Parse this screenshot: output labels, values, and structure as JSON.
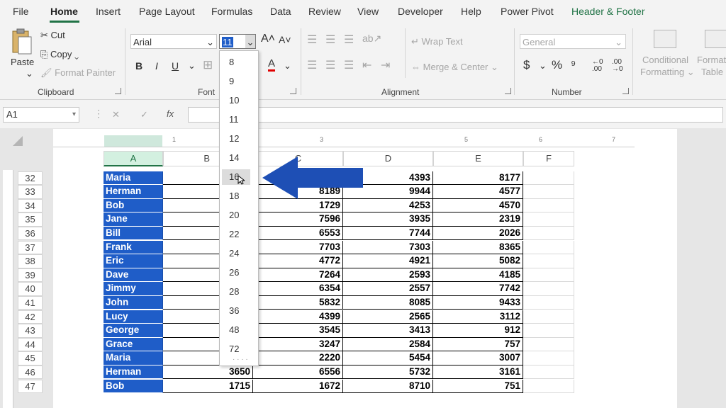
{
  "tabs": [
    "File",
    "Home",
    "Insert",
    "Page Layout",
    "Formulas",
    "Data",
    "Review",
    "View",
    "Developer",
    "Help",
    "Power Pivot",
    "Header & Footer"
  ],
  "clipboard": {
    "paste": "Paste",
    "cut": "Cut",
    "copy": "Copy",
    "format_painter": "Format Painter",
    "label": "Clipboard"
  },
  "font": {
    "name": "Arial",
    "size": "11",
    "bold": "B",
    "italic": "I",
    "underline": "U",
    "label": "Font",
    "font_color_glyph": "A"
  },
  "alignment": {
    "wrap_text": "Wrap Text",
    "merge_center": "Merge & Center",
    "label": "Alignment"
  },
  "number": {
    "format": "General",
    "currency": "$",
    "percent": "%",
    "label": "Number"
  },
  "styles": {
    "conditional": "Conditional",
    "formatting": "Formatting",
    "format_as": "Format a",
    "table": "Table"
  },
  "formula_bar": {
    "name_box": "A1",
    "fx": "fx",
    "cancel": "✕",
    "enter": "✓"
  },
  "ruler_marks": [
    "1",
    "3",
    "5",
    "6",
    "7"
  ],
  "columns": [
    "A",
    "B",
    "C",
    "D",
    "E",
    "F"
  ],
  "rows": [
    {
      "n": "32",
      "name": "Maria",
      "b": "",
      "c": "",
      "d": "4393",
      "e": "8177"
    },
    {
      "n": "33",
      "name": "Herman",
      "b": "",
      "c": "8189",
      "d": "9944",
      "e": "4577"
    },
    {
      "n": "34",
      "name": "Bob",
      "b": "",
      "c": "1729",
      "d": "4253",
      "e": "4570"
    },
    {
      "n": "35",
      "name": "Jane",
      "b": "",
      "c": "7596",
      "d": "3935",
      "e": "2319"
    },
    {
      "n": "36",
      "name": "Bill",
      "b": "",
      "c": "6553",
      "d": "7744",
      "e": "2026"
    },
    {
      "n": "37",
      "name": "Frank",
      "b": "",
      "c": "7703",
      "d": "7303",
      "e": "8365"
    },
    {
      "n": "38",
      "name": "Eric",
      "b": "",
      "c": "4772",
      "d": "4921",
      "e": "5082"
    },
    {
      "n": "39",
      "name": "Dave",
      "b": "",
      "c": "7264",
      "d": "2593",
      "e": "4185"
    },
    {
      "n": "40",
      "name": "Jimmy",
      "b": "",
      "c": "6354",
      "d": "2557",
      "e": "7742"
    },
    {
      "n": "41",
      "name": "John",
      "b": "",
      "c": "5832",
      "d": "8085",
      "e": "9433"
    },
    {
      "n": "42",
      "name": "Lucy",
      "b": "",
      "c": "4399",
      "d": "2565",
      "e": "3112"
    },
    {
      "n": "43",
      "name": "George",
      "b": "",
      "c": "3545",
      "d": "3413",
      "e": "912"
    },
    {
      "n": "44",
      "name": "Grace",
      "b": "",
      "c": "3247",
      "d": "2584",
      "e": "757"
    },
    {
      "n": "45",
      "name": "Maria",
      "b": "",
      "c": "2220",
      "d": "5454",
      "e": "3007"
    },
    {
      "n": "46",
      "name": "Herman",
      "b": "3650",
      "c": "6556",
      "d": "5732",
      "e": "3161"
    },
    {
      "n": "47",
      "name": "Bob",
      "b": "1715",
      "c": "1672",
      "d": "8710",
      "e": "751"
    }
  ],
  "font_sizes": [
    "8",
    "9",
    "10",
    "11",
    "12",
    "14",
    "16",
    "18",
    "20",
    "22",
    "24",
    "26",
    "28",
    "36",
    "48",
    "72"
  ],
  "highlighted_size": "16",
  "colors": {
    "accent": "#217346",
    "name_fill": "#1f5dc8",
    "arrow": "#1e4fb5"
  }
}
